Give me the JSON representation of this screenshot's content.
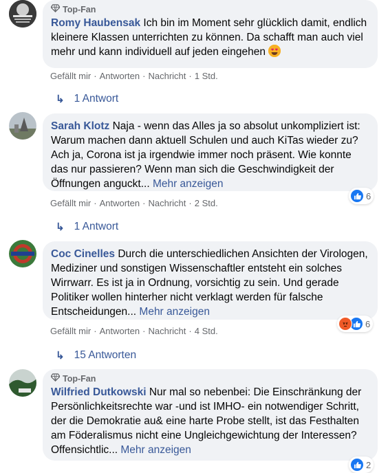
{
  "comments": [
    {
      "badge": "Top-Fan",
      "author": "Romy Haubensak",
      "text": "Ich bin im Moment sehr glücklich damit, endlich kleinere Klassen unterrichten zu können. Da schafft man auch viel mehr und kann individuell auf jeden eingehen",
      "emoji": "heart-eyes",
      "more": "",
      "actions": [
        "Gefällt mir",
        "Antworten",
        "Nachricht",
        "1 Std."
      ],
      "replies": "1 Antwort",
      "reaction_count": ""
    },
    {
      "badge": "",
      "author": "Sarah Klotz",
      "text": "Naja - wenn das Alles ja so absolut unkompliziert ist: Warum machen dann aktuell Schulen und auch KiTas wieder zu? Ach ja, Corona ist ja irgendwie immer noch präsent. Wie konnte das nur passieren? Wenn man sich die Geschwindigkeit der Öffnungen anguckt...",
      "more": "Mehr anzeigen",
      "actions": [
        "Gefällt mir",
        "Antworten",
        "Nachricht",
        "2 Std."
      ],
      "replies": "1 Antwort",
      "reaction_count": "6",
      "reactions": [
        "like"
      ]
    },
    {
      "badge": "",
      "author": "Coc Cinelles",
      "text": "Durch die unterschiedlichen Ansichten der Virologen, Mediziner und sonstigen Wissenschaftler entsteht ein solches Wirrwarr. Es ist ja in Ordnung, vorsichtig zu sein. Und gerade Politiker wollen hinterher nicht verklagt werden für falsche Entscheidungen...",
      "more": "Mehr anzeigen",
      "actions": [
        "Gefällt mir",
        "Antworten",
        "Nachricht",
        "4 Std."
      ],
      "replies": "15 Antworten",
      "reaction_count": "6",
      "reactions": [
        "angry",
        "like"
      ]
    },
    {
      "badge": "Top-Fan",
      "author": "Wilfried Dutkowski",
      "text": "Nur mal so nebenbei: Die Einschränkung der Persönlichkeitsrechte war -und ist IMHO- ein notwendiger Schritt, der die Demokratie au& eine harte Probe stellt, ist das Festhalten am Föderalismus nicht eine Ungleichgewichtung der Interessen? Offensichtlic...",
      "more": "Mehr anzeigen",
      "reaction_count": "2",
      "reactions": [
        "like"
      ]
    }
  ],
  "colors": {
    "link": "#385898",
    "bubble": "#f0f2f5",
    "meta": "#65676b",
    "like": "#1877f2",
    "angry": "#f05a27"
  },
  "icons": {
    "badge": "diamond-icon",
    "reply": "reply-arrow-icon",
    "like": "thumbs-up-icon",
    "angry": "angry-face-icon"
  }
}
